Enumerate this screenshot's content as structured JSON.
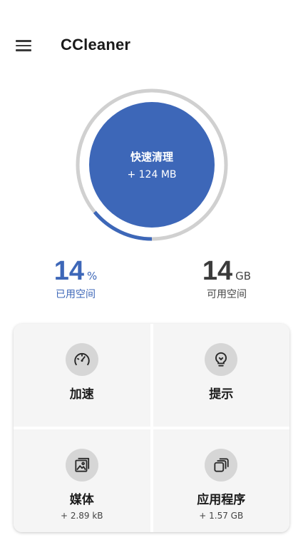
{
  "header": {
    "title": "CCleaner",
    "menu_icon": "hamburger-menu-icon"
  },
  "storage": {
    "clean_button": {
      "title": "快速清理",
      "subtitle": "+ 124 MB"
    },
    "used_fraction": 0.14,
    "colors": {
      "accent": "#3d67b8",
      "track": "#d0d0d0"
    },
    "used": {
      "value": "14",
      "unit": "%",
      "label": "已用空间"
    },
    "free": {
      "value": "14",
      "unit": "GB",
      "label": "可用空间"
    }
  },
  "features": [
    {
      "label": "加速",
      "subtitle": "",
      "icon": "speedometer-icon"
    },
    {
      "label": "提示",
      "subtitle": "",
      "icon": "lightbulb-icon"
    },
    {
      "label": "媒体",
      "subtitle": "+ 2.89 kB",
      "icon": "image-gallery-icon"
    },
    {
      "label": "应用程序",
      "subtitle": "+ 1.57 GB",
      "icon": "stacked-apps-icon"
    }
  ]
}
